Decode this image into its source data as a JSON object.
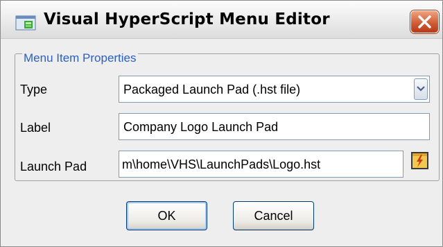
{
  "window": {
    "title": "Visual HyperScript Menu Editor",
    "icon": "app-icon",
    "close_icon": "close-icon"
  },
  "group": {
    "title": "Menu Item Properties"
  },
  "form": {
    "type_label": "Type",
    "type_value": "Packaged Launch Pad (.hst file)",
    "label_label": "Label",
    "label_value": "Company Logo Launch Pad",
    "launchpad_label": "Launch Pad",
    "launchpad_value": "m\\home\\VHS\\LaunchPads\\Logo.hst",
    "browse_icon": "browse-file-icon"
  },
  "buttons": {
    "ok": "OK",
    "cancel": "Cancel"
  },
  "colors": {
    "group_title": "#2a5fc6",
    "close_button": "#d05730",
    "field_border": "#7f9db9"
  }
}
